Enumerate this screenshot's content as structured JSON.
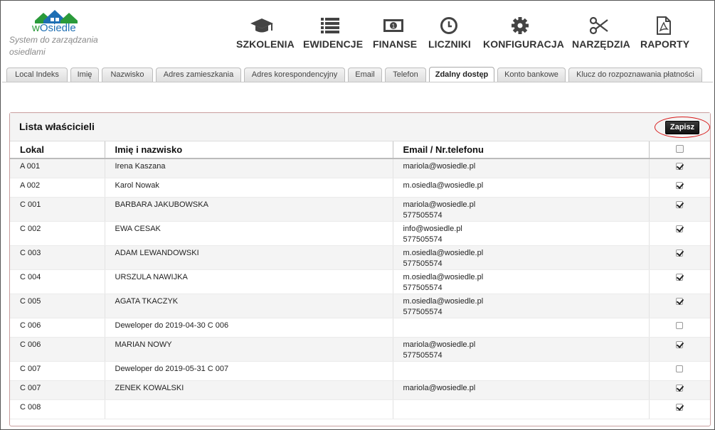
{
  "app": {
    "logo_prefix": "w",
    "logo_name": "Osiedle",
    "tagline": "System do zarządzania osiedlami"
  },
  "nav": [
    {
      "label": "SZKOLENIA",
      "icon": "graduation-cap-icon"
    },
    {
      "label": "EWIDENCJE",
      "icon": "list-icon"
    },
    {
      "label": "FINANSE",
      "icon": "money-icon"
    },
    {
      "label": "LICZNIKI",
      "icon": "clock-icon"
    },
    {
      "label": "KONFIGURACJA",
      "icon": "gear-icon"
    },
    {
      "label": "NARZĘDZIA",
      "icon": "scissors-icon"
    },
    {
      "label": "RAPORTY",
      "icon": "pdf-file-icon"
    }
  ],
  "tabs": [
    {
      "label": "Local Indeks",
      "active": false
    },
    {
      "label": "Imię",
      "active": false
    },
    {
      "label": "Nazwisko",
      "active": false
    },
    {
      "label": "Adres zamieszkania",
      "active": false
    },
    {
      "label": "Adres korespondencyjny",
      "active": false
    },
    {
      "label": "Email",
      "active": false
    },
    {
      "label": "Telefon",
      "active": false
    },
    {
      "label": "Zdalny dostęp",
      "active": true
    },
    {
      "label": "Konto bankowe",
      "active": false
    },
    {
      "label": "Klucz do rozpoznawania płatności",
      "active": false
    }
  ],
  "panel": {
    "title": "Lista właścicieli",
    "save_label": "Zapisz"
  },
  "table": {
    "headers": [
      "Lokal",
      "Imię i nazwisko",
      "Email / Nr.telefonu"
    ],
    "header_checked": false,
    "rows": [
      {
        "lokal": "A 001",
        "name": "Irena Kaszana",
        "email": "mariola@wosiedle.pl",
        "phone": "",
        "checked": true
      },
      {
        "lokal": "A 002",
        "name": "Karol Nowak",
        "email": "m.osiedla@wosiedle.pl",
        "phone": "",
        "checked": true
      },
      {
        "lokal": "C 001",
        "name": "BARBARA JAKUBOWSKA",
        "email": "mariola@wosiedle.pl",
        "phone": "577505574",
        "checked": true
      },
      {
        "lokal": "C 002",
        "name": "EWA CESAK",
        "email": "info@wosiedle.pl",
        "phone": "577505574",
        "checked": true
      },
      {
        "lokal": "C 003",
        "name": "ADAM LEWANDOWSKI",
        "email": "m.osiedla@wosiedle.pl",
        "phone": "577505574",
        "checked": true
      },
      {
        "lokal": "C 004",
        "name": "URSZULA NAWIJKA",
        "email": "m.osiedla@wosiedle.pl",
        "phone": "577505574",
        "checked": true
      },
      {
        "lokal": "C 005",
        "name": "AGATA TKACZYK",
        "email": "m.osiedla@wosiedle.pl",
        "phone": "577505574",
        "checked": true
      },
      {
        "lokal": "C 006",
        "name": "Deweloper do 2019-04-30 C 006",
        "email": "",
        "phone": "",
        "checked": false
      },
      {
        "lokal": "C 006",
        "name": "MARIAN NOWY",
        "email": "mariola@wosiedle.pl",
        "phone": "577505574",
        "checked": true
      },
      {
        "lokal": "C 007",
        "name": "Deweloper do 2019-05-31 C 007",
        "email": "",
        "phone": "",
        "checked": false
      },
      {
        "lokal": "C 007",
        "name": "ZENEK KOWALSKI",
        "email": "mariola@wosiedle.pl",
        "phone": "",
        "checked": true
      },
      {
        "lokal": "C 008",
        "name": "",
        "email": "",
        "phone": "",
        "checked": true
      }
    ]
  },
  "colors": {
    "accent_red": "#d81c1c",
    "logo_blue": "#1e6fb4",
    "logo_green": "#2a9a3a"
  }
}
